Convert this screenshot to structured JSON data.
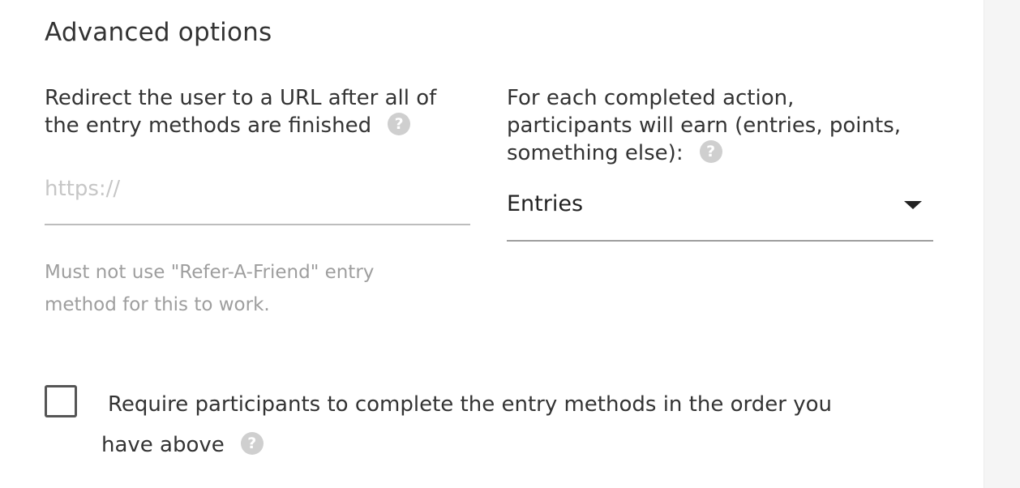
{
  "advanced": {
    "title": "Advanced options",
    "redirect": {
      "label_line1": "Redirect the user to a URL after all of",
      "label_line2": "the entry methods are finished",
      "placeholder": "https://",
      "value": "",
      "hint_line1": "Must not use \"Refer-A-Friend\" entry",
      "hint_line2": "method for this to work."
    },
    "earn": {
      "label_line1": "For each completed action,",
      "label_line2": "participants will earn (entries, points,",
      "label_line3": "something else):",
      "selected": "Entries"
    },
    "order": {
      "checked": false,
      "label_line1": "Require participants to complete the entry methods in the order you",
      "label_line2": "have above"
    },
    "help_glyph": "?",
    "icons": {
      "help": "question-circle-icon",
      "dropdown": "caret-down-icon"
    },
    "colors": {
      "text": "#333333",
      "muted": "#9e9e9e",
      "help_icon_bg": "#cfcfcf"
    }
  }
}
